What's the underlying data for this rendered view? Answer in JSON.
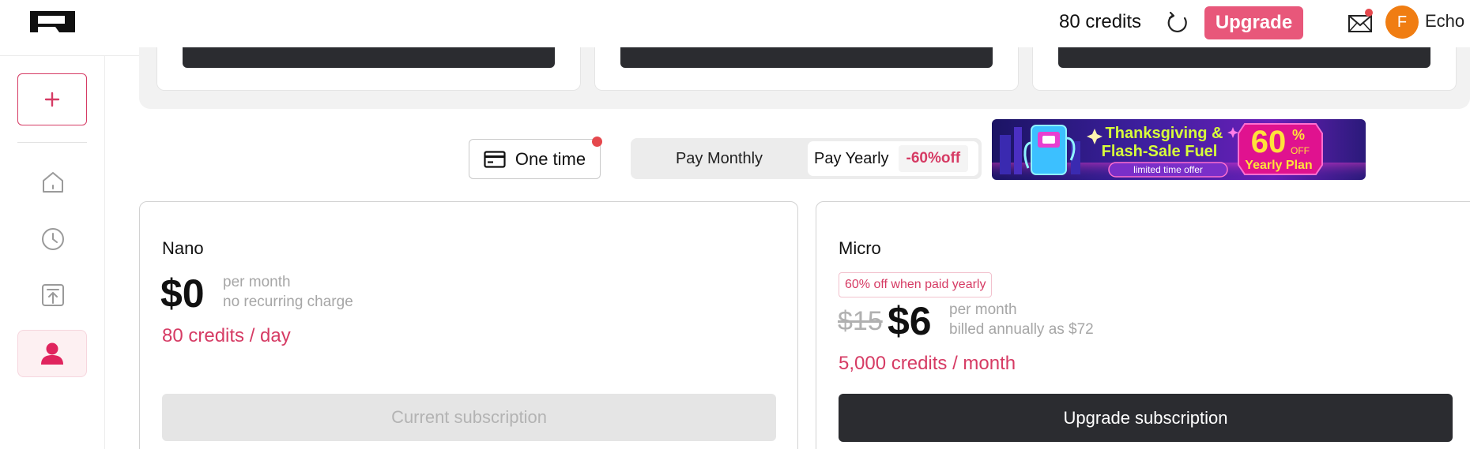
{
  "header": {
    "credits": "80 credits",
    "upgrade_label": "Upgrade",
    "avatar_initial": "F",
    "username": "Echo"
  },
  "billing": {
    "one_time_label": "One time",
    "monthly_label": "Pay Monthly",
    "yearly_label": "Pay Yearly",
    "yearly_discount": "-60%off",
    "selected": "yearly"
  },
  "promo": {
    "title_line1": "Thanksgiving &",
    "title_line2": "Flash-Sale Fuel",
    "tagline": "limited time offer",
    "percent": "60",
    "percent_sign": "%",
    "off": "OFF",
    "plan": "Yearly Plan"
  },
  "plans": [
    {
      "name": "Nano",
      "price": "$0",
      "period": "per month",
      "note": "no recurring charge",
      "credits": "80 credits / day",
      "button": "Current subscription"
    },
    {
      "name": "Micro",
      "badge": "60% off when paid yearly",
      "original_price": "$15",
      "price": "$6",
      "period": "per month",
      "note": "billed annually as $72",
      "credits": "5,000 credits / month",
      "button": "Upgrade subscription"
    }
  ],
  "colors": {
    "accent": "#d63b64",
    "upgrade": "#e8577a",
    "dark_button": "#2b2c30",
    "avatar": "#f07d12"
  }
}
